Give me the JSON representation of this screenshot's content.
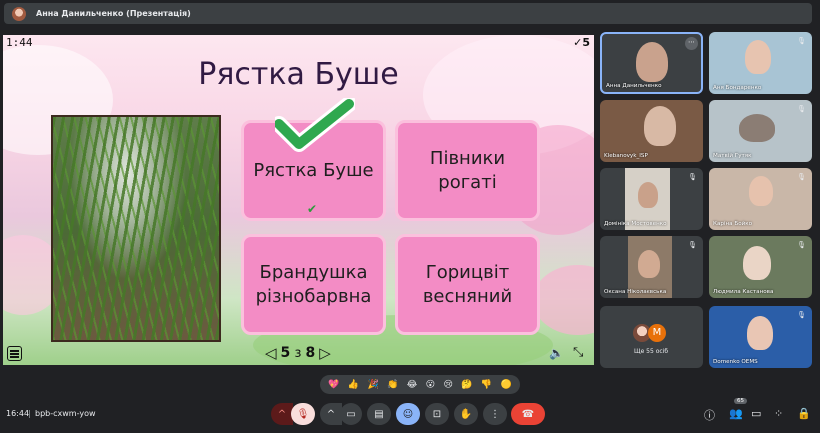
{
  "presenter_bar": {
    "label": "Анна Данильченко (Презентація)"
  },
  "slide": {
    "timer": "1:44",
    "score": "✓5",
    "title": "Рястка Буше",
    "answers": [
      {
        "text": "Рястка Буше",
        "correct": true
      },
      {
        "text": "Півники рогаті",
        "correct": false
      },
      {
        "text": "Брандушка різнобарвна",
        "correct": false
      },
      {
        "text": "Горицвіт весняний",
        "correct": false
      }
    ],
    "nav": {
      "current": "5",
      "of": "з",
      "total": "8",
      "prev_icon": "◁",
      "next_icon": "▷"
    },
    "checkmark": "✔"
  },
  "participants": [
    {
      "name": "Анна Данильченко",
      "muted": false,
      "active": true
    },
    {
      "name": "Аня Бондаренко",
      "muted": true
    },
    {
      "name": "Klebanovyk_ISP",
      "muted": false
    },
    {
      "name": "Матвій Гутяк",
      "muted": true
    },
    {
      "name": "Домініка Мостовенко",
      "muted": true
    },
    {
      "name": "Каріна Бойко",
      "muted": true
    },
    {
      "name": "Оксана Ніколаєвська",
      "muted": true
    },
    {
      "name": "Людмила Кастанова",
      "muted": true
    },
    {
      "name": "Domenko OEMS",
      "muted": true
    }
  ],
  "more_tile": {
    "text": "Ще 55 осіб",
    "avatar_letter": "M"
  },
  "reactions": [
    "💖",
    "👍",
    "🎉",
    "👏",
    "😂",
    "😮",
    "😢",
    "🤔",
    "👎",
    "🟡"
  ],
  "bottom": {
    "time": "16:44",
    "separator": "|",
    "meeting_code": "bpb-cxwm-yow",
    "participants_badge": "65",
    "colors": {
      "end_call": "#ea4335",
      "active_control": "#8ab4f8"
    }
  }
}
